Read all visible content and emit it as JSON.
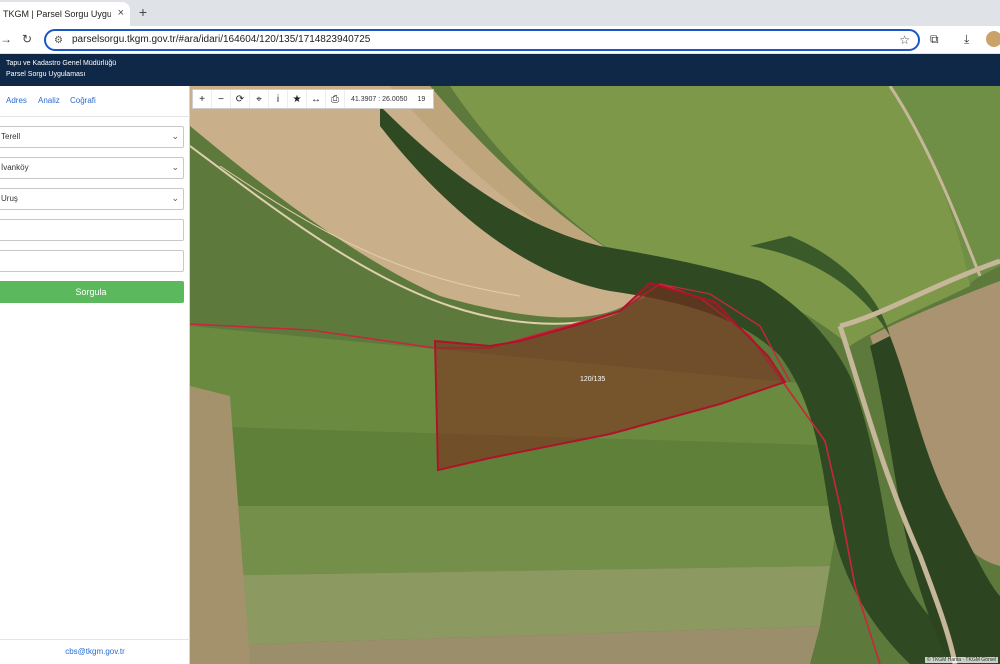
{
  "browser": {
    "tab_title": "TKGM | Parsel Sorgu Uygulama",
    "tab_close": "×",
    "new_tab": "+",
    "url": "parselsorgu.tkgm.gov.tr/#ara/idari/164604/120/135/1714823940725"
  },
  "app": {
    "header_line1": "Tapu ve Kadastro Genel Müdürlüğü",
    "header_line2": "Parsel Sorgu Uygulaması"
  },
  "sidebar": {
    "tabs": [
      {
        "label": "Adres"
      },
      {
        "label": "Analiz"
      },
      {
        "label": "Coğrafi"
      }
    ],
    "fields": [
      {
        "value": "Terell"
      },
      {
        "value": "İvanköy"
      },
      {
        "value": "Uruş"
      },
      {
        "value": ""
      },
      {
        "value": ""
      }
    ],
    "query_button": "Sorgula",
    "footer_email": "cbs@tkgm.gov.tr"
  },
  "map": {
    "coords": "41.3907 : 26.0050",
    "zoom": "19",
    "parcel_label": "120/135",
    "attribution": "© TKGM Harita · TKGM Görsel"
  },
  "colors": {
    "header_bg": "#0f2847",
    "accent_link": "#2a6bd1",
    "query_button": "#5cb85c",
    "parcel_border": "#b0122a",
    "parcel_fill": "#8a2d1f",
    "omnibox_border": "#1a56c8"
  }
}
